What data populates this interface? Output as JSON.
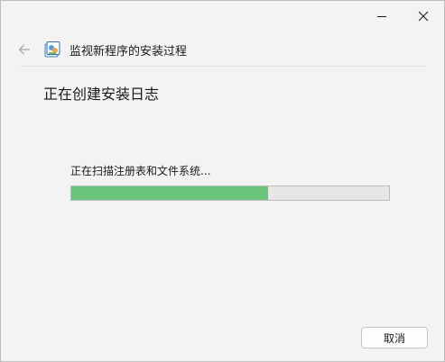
{
  "window": {
    "minimize_icon": "minimize-icon",
    "close_icon": "close-icon"
  },
  "nav": {
    "back_icon": "back-arrow-icon",
    "app_icon": "installer-app-icon",
    "title": "监视新程序的安装过程"
  },
  "main": {
    "heading": "正在创建安装日志",
    "status": "正在扫描注册表和文件系统...",
    "progress_percent": 62,
    "progress_color": "#6bc47c"
  },
  "footer": {
    "cancel_label": "取消"
  }
}
